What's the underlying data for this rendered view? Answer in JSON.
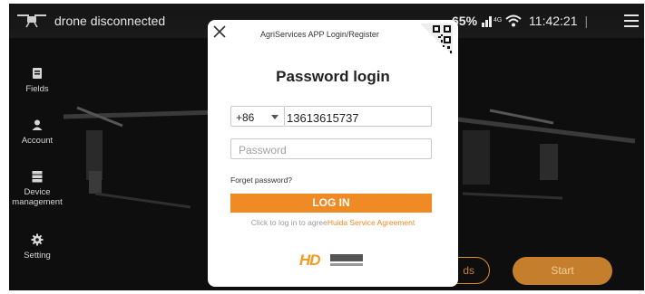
{
  "topbar": {
    "drone_status": "drone disconnected",
    "battery": "65%",
    "signal_label": "4G",
    "clock": "11:42:21",
    "separator": "|"
  },
  "sidebar": {
    "items": [
      {
        "label": "Fields",
        "icon": "fields-icon"
      },
      {
        "label": "Account",
        "icon": "account-icon"
      },
      {
        "label": "Device management",
        "icon": "device-icon"
      },
      {
        "label": "Setting",
        "icon": "setting-icon"
      }
    ]
  },
  "background_buttons": {
    "outline_label": "ds",
    "start_label": "Start"
  },
  "modal": {
    "header": "AgriServices APP Login/Register",
    "title": "Password login",
    "country_code": "+86",
    "phone_value": "13613615737",
    "password_placeholder": "Password",
    "forget_password": "Forget password?",
    "login_button": "LOG IN",
    "agree_prefix": "Click to log in to agree",
    "agree_link": "Huida Service Agreement",
    "logo_text": "HD"
  },
  "colors": {
    "accent": "#f08a24",
    "start_button": "#c57e2c",
    "link": "#ee8a24"
  }
}
